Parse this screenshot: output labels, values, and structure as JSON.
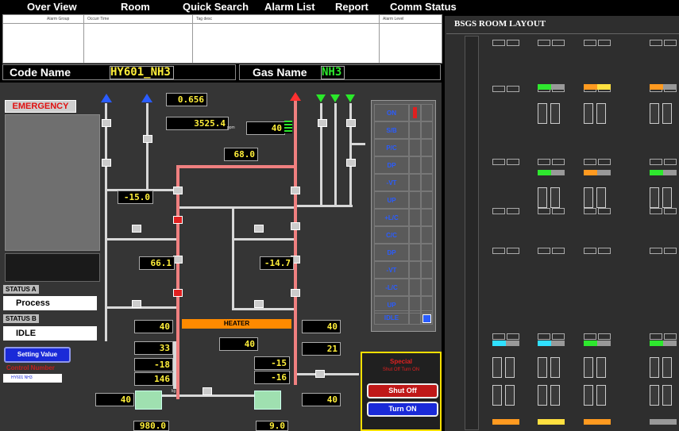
{
  "menu": [
    "Over View",
    "Room",
    "Quick Search",
    "Alarm List",
    "Report",
    "Comm Status"
  ],
  "alarm_table": {
    "columns": [
      "Alarm Group",
      "Occurr Time",
      "Tag desc",
      "Alarm Level"
    ]
  },
  "code": {
    "label": "Code Name",
    "value": "HY601_NH3"
  },
  "gas": {
    "label": "Gas Name",
    "value": "NH3"
  },
  "emergency": {
    "label": "EMERGENCY"
  },
  "status_a": {
    "label": "STATUS A",
    "value": "Process"
  },
  "status_b": {
    "label": "STATUS B",
    "value": "IDLE"
  },
  "setting_value": "Setting Value",
  "control_number": {
    "label": "Control Number",
    "value": "HY601 NH3"
  },
  "readings": {
    "top1": "0.656",
    "top2": "3525.4",
    "right_top": "40",
    "center": "68.0",
    "left_pt": "-15.0",
    "pt3a": "66.1",
    "pt3b": "-14.7",
    "left40": "40",
    "left33": "33",
    "left_m18": "-18",
    "left146": "146",
    "right40": "40",
    "right21": "21",
    "mid40": "40",
    "mid_m15": "-15",
    "mid_m16": "-16",
    "bottom_left40": "40",
    "bottom_right40": "40",
    "flow_a": "980.0",
    "flow_b": "9.0"
  },
  "units": {
    "ppm": "ppm",
    "kg": "kg"
  },
  "heater": "HEATER",
  "grid_rows": [
    "ON",
    "S/B",
    "P/C",
    "DP",
    "-VT",
    "UP",
    "+L/C",
    "C/C",
    "DP",
    "-VT",
    "-L/C",
    "UP",
    "IDLE"
  ],
  "control": {
    "title": "Special",
    "subtitle": "Shut Off  Turn ON",
    "shut_off": "Shut Off",
    "turn_on": "Turn ON"
  },
  "room": {
    "title": "BSGS ROOM LAYOUT"
  },
  "colors": {
    "accent_yellow": "#ffef3a",
    "gas_green": "#2ee82e",
    "emergency_red": "#e01010",
    "heater_orange": "#ff8a00",
    "ctrl_border": "#ffe000"
  }
}
